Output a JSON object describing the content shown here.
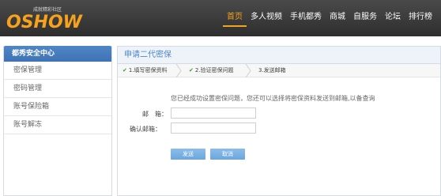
{
  "header": {
    "logo_slogan": "成就精彩社区",
    "logo_text": "OSHOW",
    "nav": [
      {
        "label": "首页",
        "active": true
      },
      {
        "label": "多人视频"
      },
      {
        "label": "手机都秀"
      },
      {
        "label": "商城"
      },
      {
        "label": "自服务"
      },
      {
        "label": "论坛"
      },
      {
        "label": "排行榜"
      }
    ],
    "accent_color": "#f6a21c"
  },
  "sidebar": {
    "title": "都秀安全中心",
    "items": [
      "密保管理",
      "密码管理",
      "账号保险箱",
      "账号解冻"
    ]
  },
  "main": {
    "title": "申请二代密保",
    "steps": [
      {
        "label": "1.填写密保资料",
        "done": true
      },
      {
        "label": "2.验证密保问题",
        "done": true
      },
      {
        "label": "3.发送邮箱",
        "done": false
      }
    ],
    "info": "您已经成功设置密保问题，您还可以选择将密保资料发送到邮箱,以备查询",
    "form": {
      "email_label": "邮　箱：",
      "confirm_label": "确认邮箱：",
      "email_value": "",
      "confirm_value": ""
    },
    "buttons": {
      "send": "发送",
      "cancel": "取消"
    }
  },
  "icons": {
    "step_done": "check-circle-icon",
    "step_separator": "chevron-right-icon"
  }
}
